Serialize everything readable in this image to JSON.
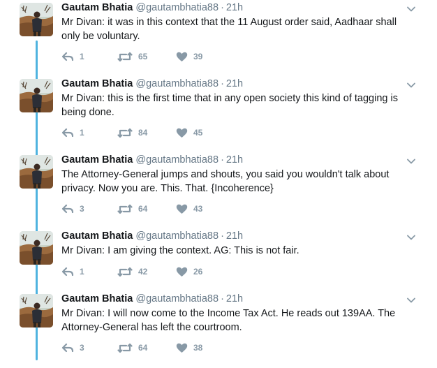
{
  "tweets": [
    {
      "name": "Gautam Bhatia",
      "handle": "@gautambhatia88",
      "dot": "·",
      "time": "21h",
      "text": "Mr Divan: it was in this context that the 11 August order said, Aadhaar shall only be voluntary.",
      "replies": "1",
      "retweets": "65",
      "likes": "39"
    },
    {
      "name": "Gautam Bhatia",
      "handle": "@gautambhatia88",
      "dot": "·",
      "time": "21h",
      "text": "Mr Divan: this is the first time that in any open society this kind of tagging is being done.",
      "replies": "1",
      "retweets": "84",
      "likes": "45"
    },
    {
      "name": "Gautam Bhatia",
      "handle": "@gautambhatia88",
      "dot": "·",
      "time": "21h",
      "text": "The Attorney-General jumps and shouts, you said you wouldn't talk about privacy. Now you are. This. That. {Incoherence}",
      "replies": "3",
      "retweets": "64",
      "likes": "43"
    },
    {
      "name": "Gautam Bhatia",
      "handle": "@gautambhatia88",
      "dot": "·",
      "time": "21h",
      "text": "Mr Divan: I am giving the context. AG: This is not fair.",
      "replies": "1",
      "retweets": "42",
      "likes": "26"
    },
    {
      "name": "Gautam Bhatia",
      "handle": "@gautambhatia88",
      "dot": "·",
      "time": "21h",
      "text": "Mr Divan: I will now come to the Income Tax Act. He reads out 139AA. The Attorney-General has left the courtroom.",
      "replies": "3",
      "retweets": "64",
      "likes": "38"
    }
  ],
  "icons": {
    "reply": "reply-icon",
    "retweet": "retweet-icon",
    "like": "heart-icon",
    "more": "chevron-down-icon",
    "avatar": "avatar"
  },
  "colors": {
    "thread_line": "#4fb3df",
    "secondary_text": "#657786",
    "action_icon": "#8899a6"
  }
}
